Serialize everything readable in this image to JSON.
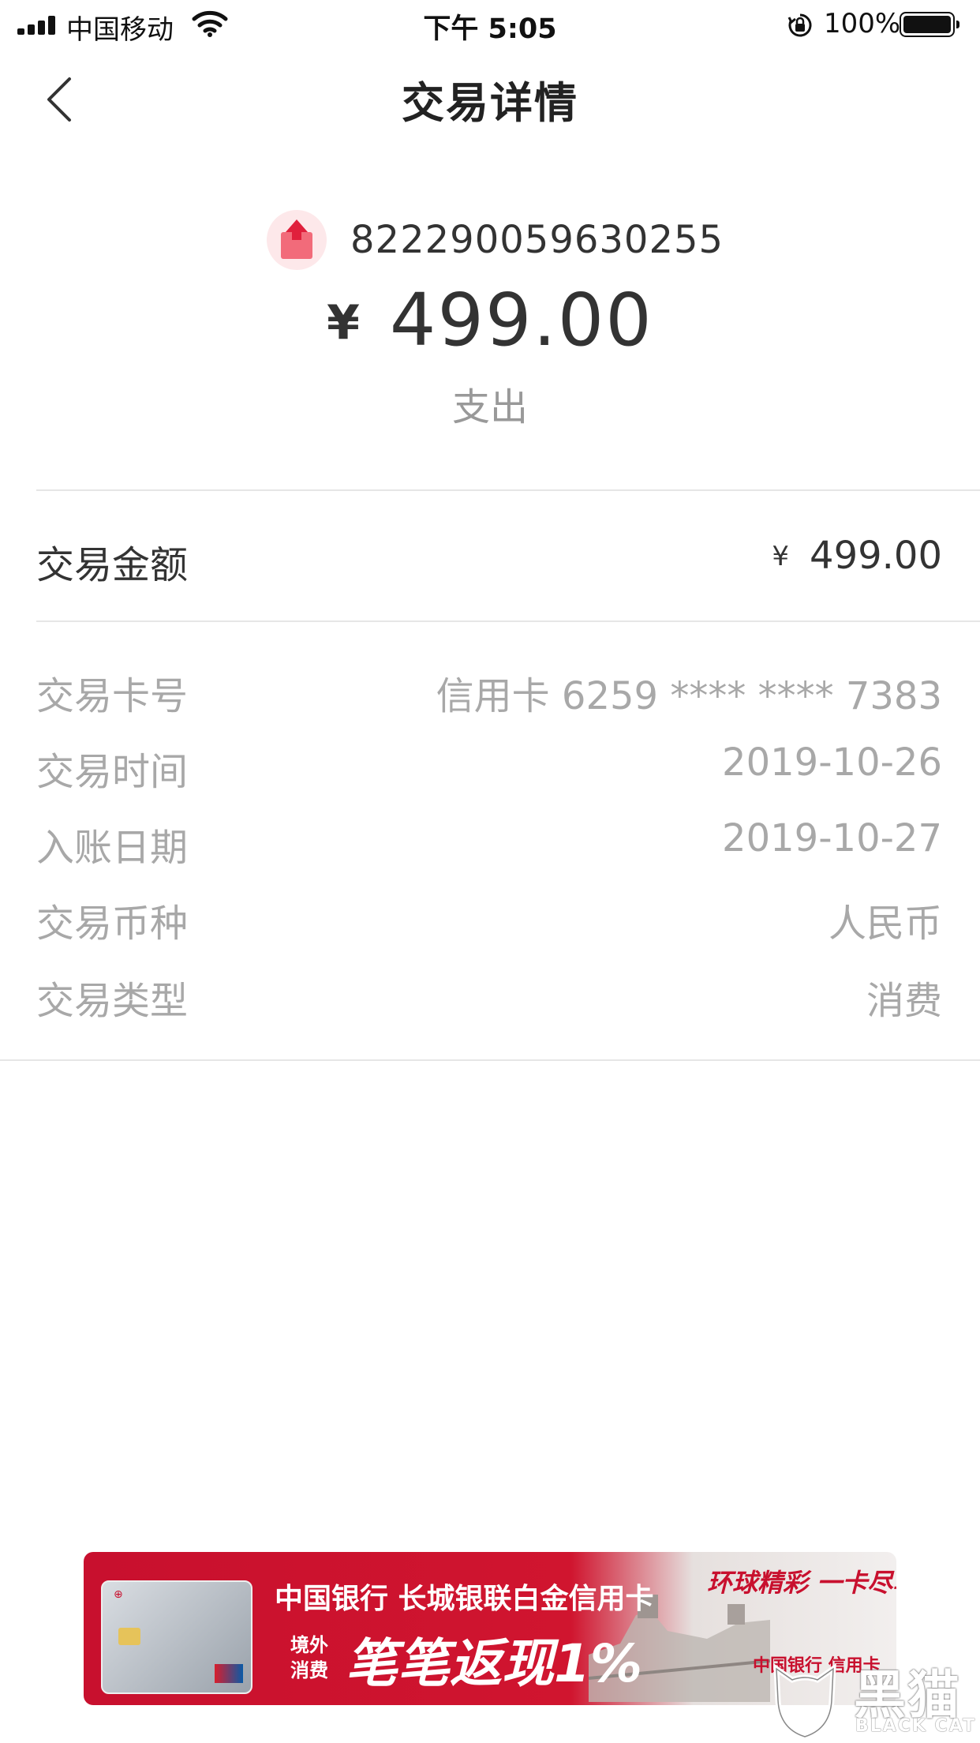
{
  "status_bar": {
    "carrier": "中国移动",
    "time": "下午 5:05",
    "battery": "100%",
    "icons": [
      "signal-icon",
      "wifi-icon",
      "orientation-lock-icon",
      "battery-icon"
    ]
  },
  "nav": {
    "title": "交易详情",
    "back_icon": "chevron-left-icon"
  },
  "summary": {
    "icon": "expense-icon",
    "transaction_id": "822290059630255",
    "currency_symbol": "¥",
    "amount": "499.00",
    "direction": "支出"
  },
  "amount_row": {
    "label": "交易金额",
    "currency_symbol": "¥",
    "value": "499.00"
  },
  "details": [
    {
      "label": "交易卡号",
      "value": "信用卡 6259 **** **** 7383"
    },
    {
      "label": "交易时间",
      "value": "2019-10-26"
    },
    {
      "label": "入账日期",
      "value": "2019-10-27"
    },
    {
      "label": "交易币种",
      "value": "人民币"
    },
    {
      "label": "交易类型",
      "value": "消费"
    }
  ],
  "banner": {
    "line1": "中国银行 长城银联白金信用卡",
    "small_line1": "境外",
    "small_line2": "消费",
    "headline": "笔笔返现1%",
    "slogan": "环球精彩 一卡尽享",
    "bank": "中国银行 信用卡"
  },
  "watermark": {
    "chinese": "黑猫",
    "english": "BLACK CAT"
  },
  "colors": {
    "accent_red": "#c8102e",
    "text_primary": "#333333",
    "text_secondary": "#a8a8a8",
    "divider": "#e6e6e6"
  }
}
